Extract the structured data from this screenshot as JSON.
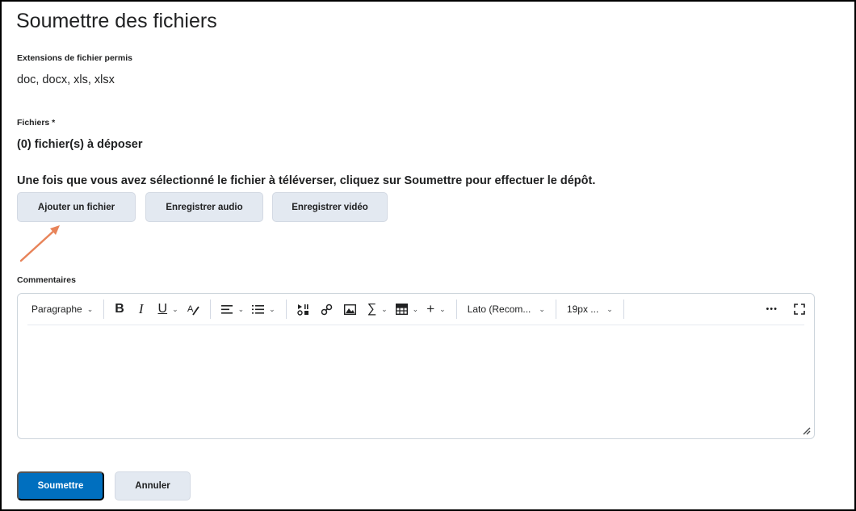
{
  "page": {
    "title": "Soumettre des fichiers"
  },
  "extensions": {
    "label": "Extensions de fichier permis",
    "value": "doc, docx, xls, xlsx"
  },
  "files": {
    "label": "Fichiers *",
    "count_text": "(0) fichier(s) à déposer"
  },
  "instructions": "Une fois que vous avez sélectionné le fichier à téléverser, cliquez sur Soumettre pour effectuer le dépôt.",
  "upload_buttons": {
    "add_file": "Ajouter un fichier",
    "record_audio": "Enregistrer audio",
    "record_video": "Enregistrer vidéo"
  },
  "comments": {
    "label": "Commentaires",
    "toolbar": {
      "paragraph": "Paragraphe",
      "font": "Lato (Recom...",
      "size": "19px ...",
      "more": "•••"
    }
  },
  "actions": {
    "submit": "Soumettre",
    "cancel": "Annuler"
  },
  "colors": {
    "primary": "#006fbf",
    "secondary_button": "#e3e9f1",
    "annotation_arrow": "#e8845a"
  }
}
